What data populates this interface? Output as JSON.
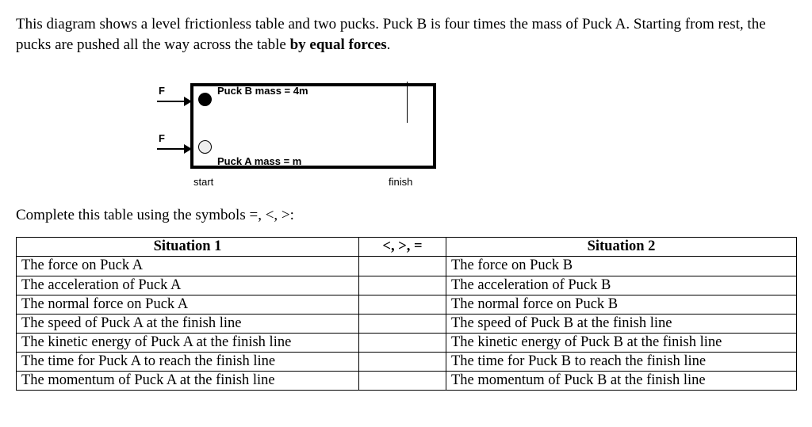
{
  "intro": {
    "part1": "This diagram shows a level frictionless table and two pucks.  Puck B is four times the mass of Puck A.  Starting from rest, the pucks are pushed all the way across the table ",
    "bold": "by equal forces",
    "part2": "."
  },
  "diagram": {
    "forceLabel": "F",
    "puckB": "Puck B mass = 4m",
    "puckA": "Puck A mass = m",
    "start": "start",
    "finish": "finish"
  },
  "instruction": "Complete this table using the symbols =, <, >:",
  "table": {
    "header": {
      "sit1": "Situation 1",
      "op": "<, >, =",
      "sit2": "Situation 2"
    },
    "rows": [
      {
        "s1": "The force on Puck A",
        "op": "",
        "s2": "The force on Puck B"
      },
      {
        "s1": "The acceleration of Puck A",
        "op": "",
        "s2": "The acceleration of Puck B"
      },
      {
        "s1": "The normal force on Puck A",
        "op": "",
        "s2": "The normal force on Puck B"
      },
      {
        "s1": "The speed of Puck A at the finish line",
        "op": "",
        "s2": "The speed of Puck B at the finish line"
      },
      {
        "s1": "The kinetic energy of Puck A at the finish line",
        "op": "",
        "s2": "The kinetic energy of Puck B at the finish line"
      },
      {
        "s1": "The time for Puck A to reach the finish line",
        "op": "",
        "s2": "The time for Puck B to reach the finish line"
      },
      {
        "s1": "The momentum of Puck A at the finish line",
        "op": "",
        "s2": "The momentum of Puck B at the finish line"
      }
    ]
  }
}
